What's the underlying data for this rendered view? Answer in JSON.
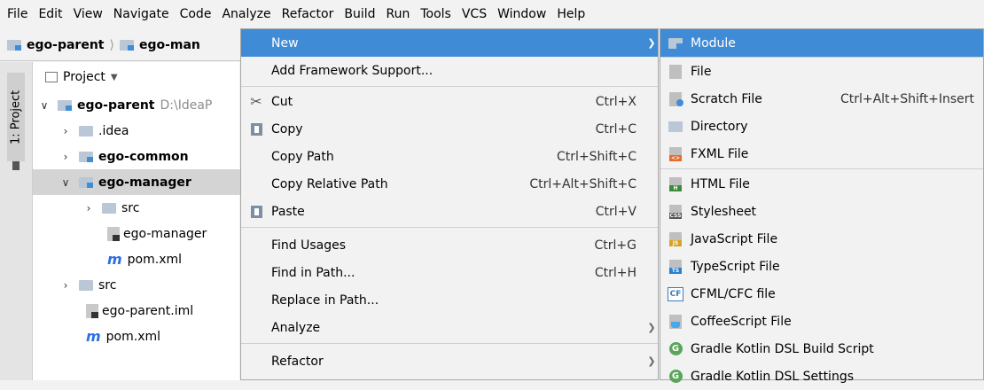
{
  "menubar": {
    "items": [
      "File",
      "Edit",
      "View",
      "Navigate",
      "Code",
      "Analyze",
      "Refactor",
      "Build",
      "Run",
      "Tools",
      "VCS",
      "Window",
      "Help"
    ]
  },
  "breadcrumb": {
    "items": [
      "ego-parent",
      "ego-man"
    ]
  },
  "sidebar": {
    "tab_label": "1: Project"
  },
  "project_panel": {
    "title": "Project",
    "tree": [
      {
        "label": "ego-parent",
        "path": "D:\\IdeaP",
        "type": "module",
        "expanded": true
      },
      {
        "label": ".idea",
        "type": "folder",
        "expanded": false
      },
      {
        "label": "ego-common",
        "type": "module",
        "expanded": false
      },
      {
        "label": "ego-manager",
        "type": "module",
        "expanded": true
      },
      {
        "label": "src",
        "type": "folder",
        "expanded": false
      },
      {
        "label": "ego-manager",
        "type": "iml"
      },
      {
        "label": "pom.xml",
        "type": "maven"
      },
      {
        "label": "src",
        "type": "folder",
        "expanded": false
      },
      {
        "label": "ego-parent.iml",
        "type": "iml"
      },
      {
        "label": "pom.xml",
        "type": "maven"
      }
    ]
  },
  "context_menu": {
    "items": [
      {
        "label": "New",
        "shortcut": "",
        "submenu": true,
        "highlighted": true
      },
      {
        "label": "Add Framework Support...",
        "shortcut": ""
      },
      {
        "label": "Cut",
        "shortcut": "Ctrl+X",
        "icon": "scissors-icon"
      },
      {
        "label": "Copy",
        "shortcut": "Ctrl+C",
        "icon": "copy-icon"
      },
      {
        "label": "Copy Path",
        "shortcut": "Ctrl+Shift+C"
      },
      {
        "label": "Copy Relative Path",
        "shortcut": "Ctrl+Alt+Shift+C"
      },
      {
        "label": "Paste",
        "shortcut": "Ctrl+V",
        "icon": "paste-icon"
      },
      {
        "label": "Find Usages",
        "shortcut": "Ctrl+G"
      },
      {
        "label": "Find in Path...",
        "shortcut": "Ctrl+H"
      },
      {
        "label": "Replace in Path...",
        "shortcut": ""
      },
      {
        "label": "Analyze",
        "shortcut": "",
        "submenu": true
      },
      {
        "label": "Refactor",
        "shortcut": "",
        "submenu": true
      }
    ]
  },
  "new_submenu": {
    "items": [
      {
        "label": "Module",
        "shortcut": "",
        "highlighted": true
      },
      {
        "label": "File",
        "shortcut": ""
      },
      {
        "label": "Scratch File",
        "shortcut": "Ctrl+Alt+Shift+Insert"
      },
      {
        "label": "Directory",
        "shortcut": ""
      },
      {
        "label": "FXML File",
        "shortcut": ""
      },
      {
        "label": "HTML File",
        "shortcut": ""
      },
      {
        "label": "Stylesheet",
        "shortcut": ""
      },
      {
        "label": "JavaScript File",
        "shortcut": ""
      },
      {
        "label": "TypeScript File",
        "shortcut": ""
      },
      {
        "label": "CFML/CFC file",
        "shortcut": ""
      },
      {
        "label": "CoffeeScript File",
        "shortcut": ""
      },
      {
        "label": "Gradle Kotlin DSL Build Script",
        "shortcut": ""
      },
      {
        "label": "Gradle Kotlin DSL Settings",
        "shortcut": ""
      }
    ]
  },
  "colors": {
    "highlight": "#3f8bd6",
    "menu_bg": "#f2f2f2",
    "selected_row": "#d4d4d4"
  }
}
